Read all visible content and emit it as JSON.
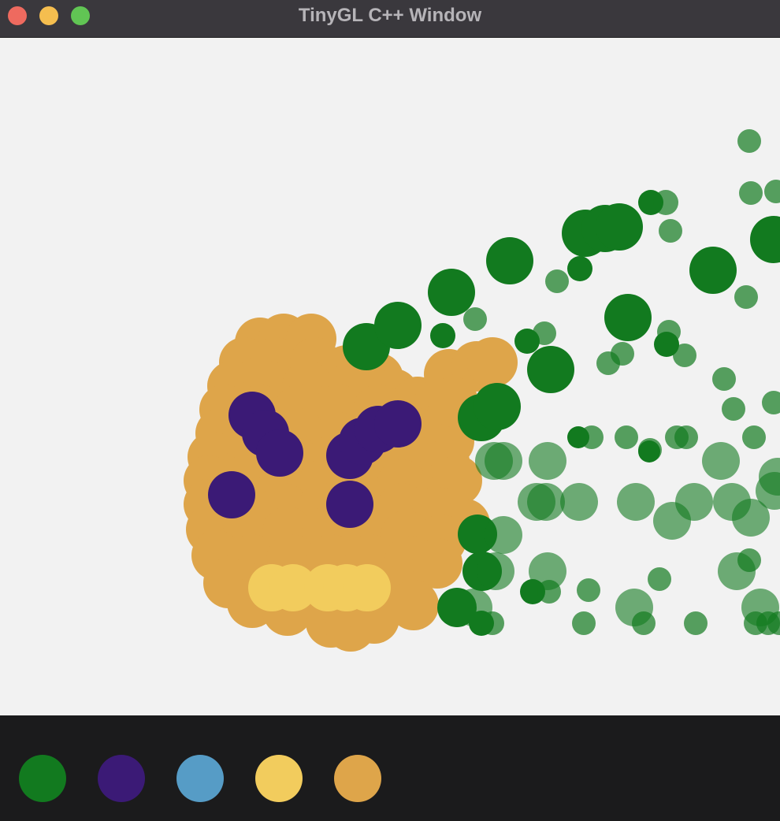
{
  "window": {
    "title": "TinyGL C++ Window",
    "controls": [
      "close",
      "minimize",
      "maximize"
    ]
  },
  "canvas": {
    "background": "#f2f2f2",
    "strokes": {
      "orange": "#dea54a",
      "purple": "#3b1a76",
      "yellow": "#f2cc5d",
      "green": "#127a1f"
    }
  },
  "palette": {
    "colors": [
      {
        "name": "green",
        "hex": "#127a1f"
      },
      {
        "name": "purple",
        "hex": "#3b1a76"
      },
      {
        "name": "blue",
        "hex": "#569cc6"
      },
      {
        "name": "yellow",
        "hex": "#f2cc5d"
      },
      {
        "name": "orange",
        "hex": "#dea54a"
      }
    ]
  }
}
